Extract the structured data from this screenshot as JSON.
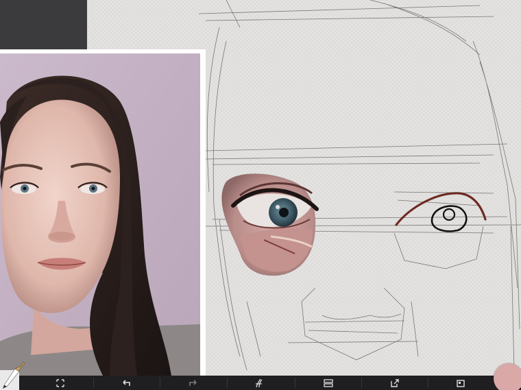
{
  "app": {
    "tool_state": {
      "active_tool": "brush",
      "current_color": "#d9a8a7"
    },
    "panels": {
      "reference_image": "reference-photo-portrait"
    },
    "toolbar": {
      "items": [
        {
          "id": "transform",
          "icon": "transform-icon"
        },
        {
          "id": "undo",
          "icon": "undo-icon"
        },
        {
          "id": "redo",
          "icon": "redo-icon"
        },
        {
          "id": "brush-settings",
          "icon": "brush-settings-icon"
        },
        {
          "id": "layers",
          "icon": "layers-icon"
        },
        {
          "id": "export",
          "icon": "export-icon"
        },
        {
          "id": "gallery",
          "icon": "gallery-icon"
        }
      ]
    }
  }
}
